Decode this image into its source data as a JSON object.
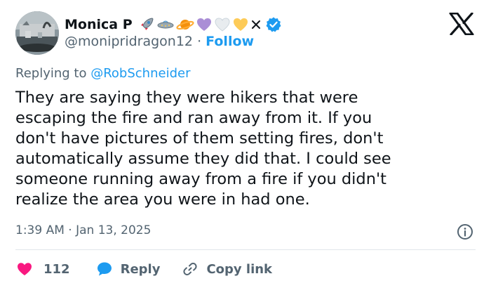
{
  "author": {
    "display_name": "Monica P",
    "emoji_icons": [
      "rocket-emoji",
      "ufo-emoji",
      "ringed-planet-emoji",
      "purple-heart-emoji",
      "white-heart-emoji",
      "yellow-heart-emoji",
      "cross-mark-emoji"
    ],
    "verified_badge_icon": "verified-badge-icon",
    "handle": "@monipridragon12",
    "separator": "·",
    "follow_label": "Follow"
  },
  "platform_logo": "x-logo",
  "reply_context": {
    "prefix": "Replying to",
    "mention": "@RobSchneider"
  },
  "tweet": {
    "text": "They are saying they were hikers that were\nescaping the fire and ran away from it. If  you\ndon't have pictures of them setting fires, don't\nautomatically assume they did that. I could see\nsomeone running away from a fire if you didn't\nrealize the area you were in had one.",
    "time": "1:39 AM",
    "separator": "·",
    "date": "Jan 13, 2025"
  },
  "actions": {
    "like_count": "112",
    "reply_label": "Reply",
    "copy_link_label": "Copy link"
  },
  "colors": {
    "accent": "#1d9bf0",
    "like": "#f91880",
    "muted_text": "#536471",
    "text": "#0f1419",
    "divider": "#e1e6ea"
  }
}
